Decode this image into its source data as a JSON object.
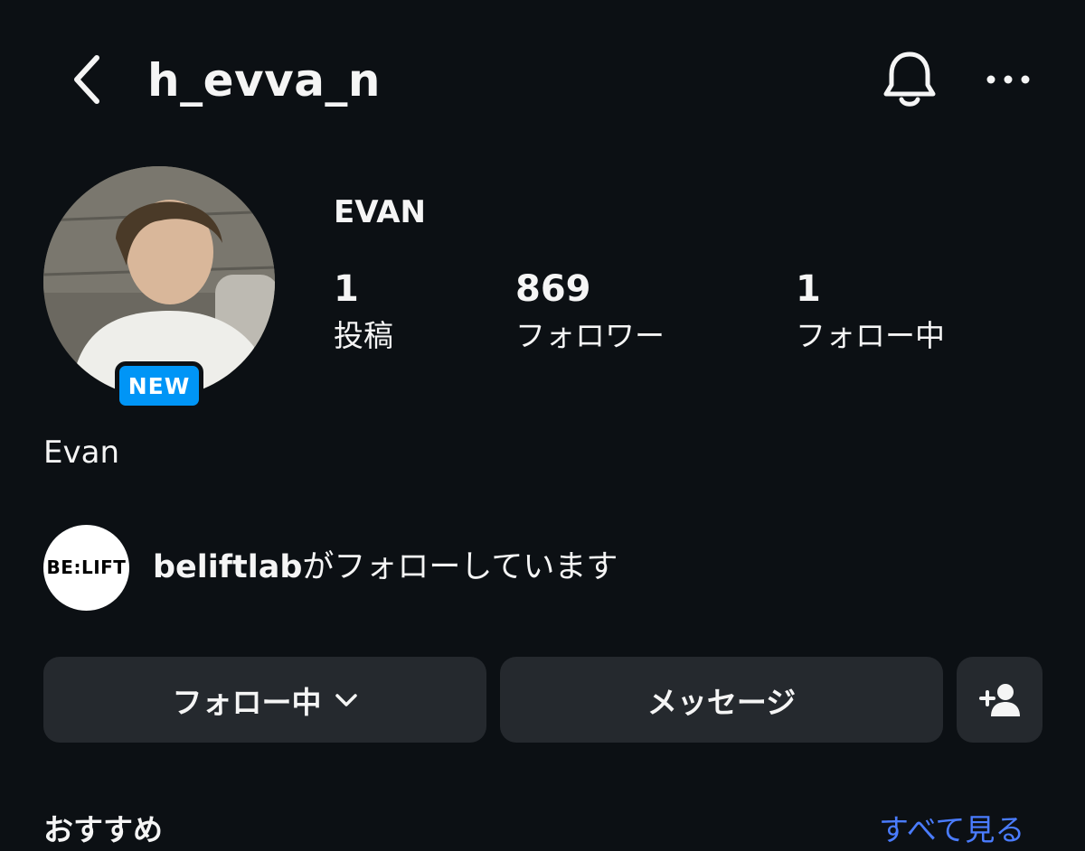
{
  "header": {
    "username": "h_evva_n",
    "back_icon": "chevron-left-icon",
    "bell_icon": "bell-icon",
    "more_icon": "ellipsis-icon"
  },
  "profile": {
    "badge": "NEW",
    "display_name": "EVAN",
    "stats": [
      {
        "count": "1",
        "label": "投稿"
      },
      {
        "count": "869",
        "label": "フォロワー"
      },
      {
        "count": "1",
        "label": "フォロー中"
      }
    ],
    "bio_name": "Evan"
  },
  "followed_by": {
    "avatar_text": "BE:LIFT",
    "account": "beliftlab",
    "text": "がフォローしています"
  },
  "actions": {
    "following_label": "フォロー中",
    "message_label": "メッセージ",
    "add_user_icon": "add-user-icon"
  },
  "suggestions": {
    "title": "おすすめ",
    "see_all": "すべて見る"
  },
  "colors": {
    "background": "#0c1014",
    "button": "#25292e",
    "badge": "#0095f6",
    "link": "#4a7cff"
  }
}
